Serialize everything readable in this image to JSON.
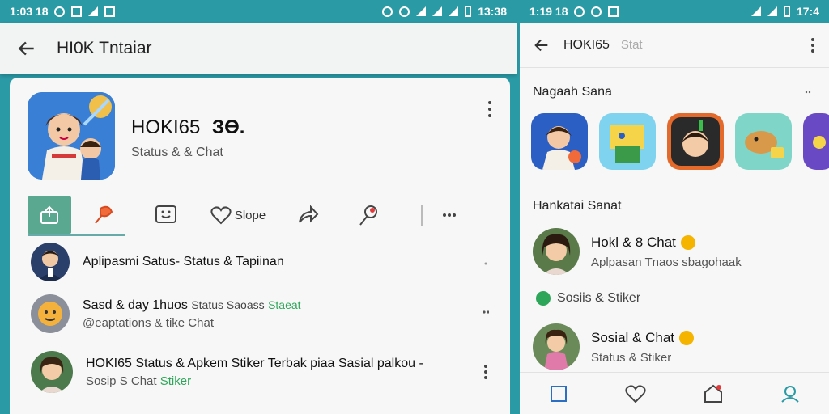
{
  "left": {
    "statusbar": {
      "time": "1:03 18",
      "right_time": "13:38"
    },
    "appbar": {
      "title": "HI0K Tntaiar"
    },
    "app": {
      "name": "HOKI65",
      "name_suffix": "ЗӨ.",
      "subtitle": "Status & & Chat"
    },
    "actions": [
      {
        "icon": "share-app-icon",
        "label": ""
      },
      {
        "icon": "pin-icon",
        "label": ""
      },
      {
        "icon": "sticker-icon",
        "label": ""
      },
      {
        "icon": "heart-icon",
        "label": "Slope"
      },
      {
        "icon": "forward-icon",
        "label": ""
      },
      {
        "icon": "location-pin-icon",
        "label": ""
      },
      {
        "icon": "more-horizontal-icon",
        "label": ""
      }
    ],
    "list": [
      {
        "title": "Aplipasmi Satus- Status & Tapiinan",
        "sub": "",
        "sub_green": ""
      },
      {
        "title": "Sasd & day 1huos",
        "title_tail": "Status Saoass",
        "title_green": "Staeat",
        "sub": "@eaptations & tike Chat",
        "sub_green": ""
      },
      {
        "title": "HOKI65 Status & Apkem Stiker Terbak piaa Sasial palkou -",
        "sub": "Sosip S Chat",
        "sub_green": "Stiker"
      }
    ]
  },
  "right": {
    "statusbar": {
      "time": "1:19 18",
      "right_time": "17:4"
    },
    "appbar": {
      "title": "HOKI65",
      "sub": "Stat"
    },
    "section1": "Nagaah Sana",
    "section2": "Hankatai Sanat",
    "rows": [
      {
        "title": "Hokl & 8 Chat",
        "sub": "Aplpasan Tnaos sbagohaak"
      },
      {
        "title": "Sosial & Chat",
        "sub": "Status & Stiker"
      }
    ],
    "tag": "Sosiis & Stiker"
  },
  "colors": {
    "teal": "#2a9aa5",
    "green": "#2ea65a",
    "active_tab": "#5aa88f",
    "badge": "#f5b400"
  }
}
